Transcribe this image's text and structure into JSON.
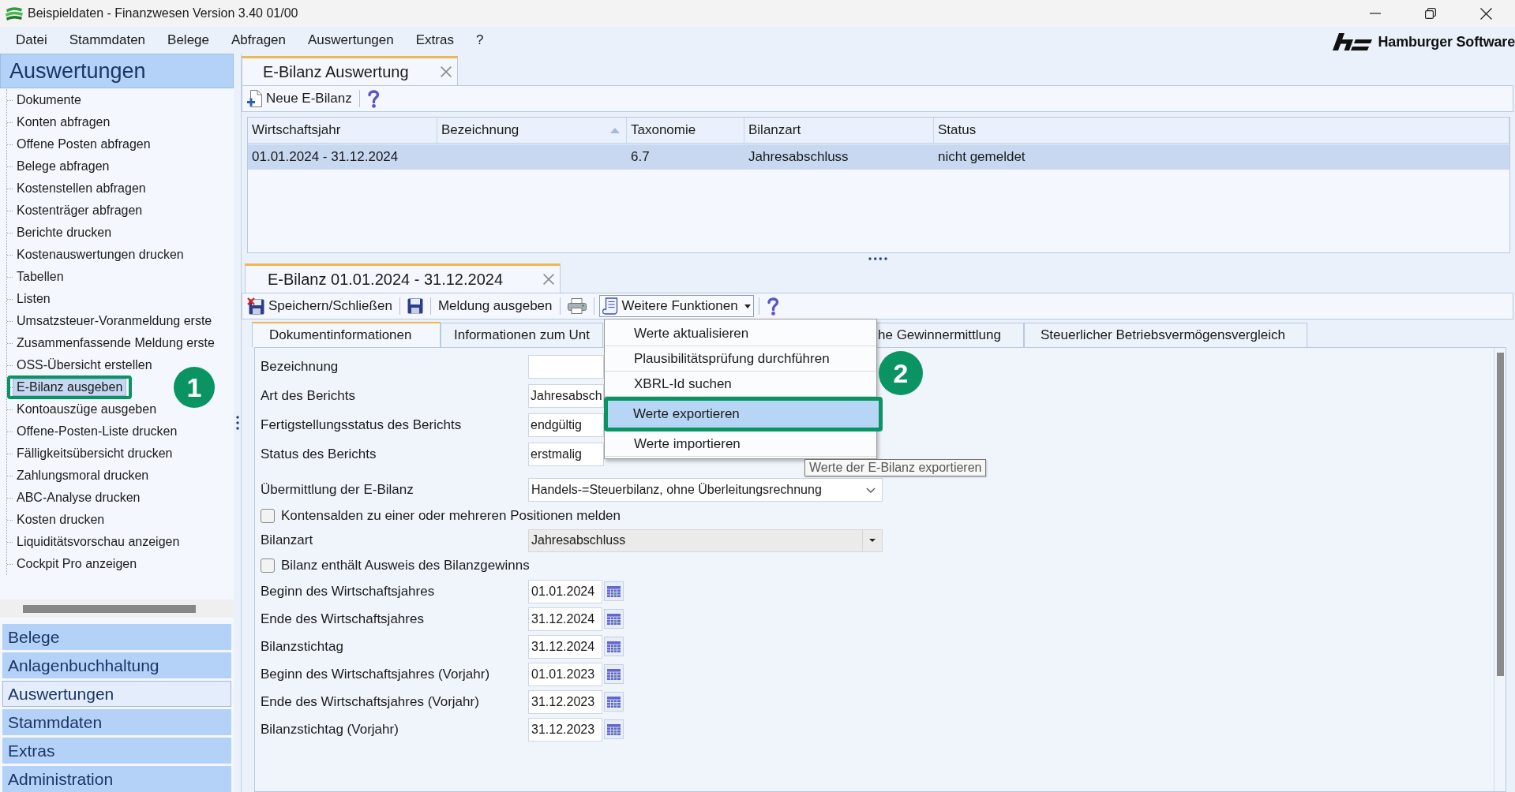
{
  "window": {
    "title": "Beispieldaten - Finanzwesen Version 3.40 01/00"
  },
  "menu_bar": [
    "Datei",
    "Stammdaten",
    "Belege",
    "Abfragen",
    "Auswertungen",
    "Extras",
    "?"
  ],
  "brand": "Hamburger Software",
  "sidebar": {
    "title": "Auswertungen",
    "items": [
      {
        "label": "Dokumente",
        "selected": false,
        "highlighted": false
      },
      {
        "label": "Konten abfragen",
        "selected": false,
        "highlighted": false
      },
      {
        "label": "Offene Posten abfragen",
        "selected": false,
        "highlighted": false
      },
      {
        "label": "Belege abfragen",
        "selected": false,
        "highlighted": false
      },
      {
        "label": "Kostenstellen abfragen",
        "selected": false,
        "highlighted": false
      },
      {
        "label": "Kostenträger abfragen",
        "selected": false,
        "highlighted": false
      },
      {
        "label": "Berichte drucken",
        "selected": false,
        "highlighted": false
      },
      {
        "label": "Kostenauswertungen drucken",
        "selected": false,
        "highlighted": false
      },
      {
        "label": "Tabellen",
        "selected": false,
        "highlighted": false
      },
      {
        "label": "Listen",
        "selected": false,
        "highlighted": false
      },
      {
        "label": "Umsatzsteuer-Voranmeldung erste",
        "selected": false,
        "highlighted": false
      },
      {
        "label": "Zusammenfassende Meldung erste",
        "selected": false,
        "highlighted": false
      },
      {
        "label": "OSS-Übersicht erstellen",
        "selected": false,
        "highlighted": false
      },
      {
        "label": "E-Bilanz ausgeben",
        "selected": true,
        "highlighted": true
      },
      {
        "label": "Kontoauszüge ausgeben",
        "selected": false,
        "highlighted": false
      },
      {
        "label": "Offene-Posten-Liste drucken",
        "selected": false,
        "highlighted": false
      },
      {
        "label": "Fälligkeitsübersicht drucken",
        "selected": false,
        "highlighted": false
      },
      {
        "label": "Zahlungsmoral drucken",
        "selected": false,
        "highlighted": false
      },
      {
        "label": "ABC-Analyse drucken",
        "selected": false,
        "highlighted": false
      },
      {
        "label": "Kosten drucken",
        "selected": false,
        "highlighted": false
      },
      {
        "label": "Liquiditätsvorschau anzeigen",
        "selected": false,
        "highlighted": false
      },
      {
        "label": "Cockpit Pro anzeigen",
        "selected": false,
        "highlighted": false
      }
    ],
    "sections": [
      {
        "label": "Belege",
        "selected": false
      },
      {
        "label": "Anlagenbuchhaltung",
        "selected": false
      },
      {
        "label": "Auswertungen",
        "selected": true
      },
      {
        "label": "Stammdaten",
        "selected": false
      },
      {
        "label": "Extras",
        "selected": false
      },
      {
        "label": "Administration",
        "selected": false
      }
    ]
  },
  "document_tab": {
    "label": "E-Bilanz Auswertung",
    "selected": true
  },
  "toolbar": [
    {
      "kind": "new",
      "label": "Neue E-Bilanz"
    },
    {
      "kind": "help"
    }
  ],
  "table": {
    "columns": [
      {
        "label": "Wirtschaftsjahr",
        "sorted": false
      },
      {
        "label": "Bezeichnung",
        "sorted": true
      },
      {
        "label": "Taxonomie",
        "sorted": false
      },
      {
        "label": "Bilanzart",
        "sorted": false
      },
      {
        "label": "Status",
        "sorted": false
      }
    ],
    "rows": [
      {
        "cells": [
          "01.01.2024 - 31.12.2024",
          null,
          "6.7",
          "Jahresabschluss",
          "nicht gemeldet"
        ],
        "selected": true
      }
    ]
  },
  "editor": {
    "tab": {
      "label": "E-Bilanz 01.01.2024 - 31.12.2024",
      "selected": true
    },
    "toolbar": [
      {
        "kind": "save_close",
        "label": "Speichern/Schließen"
      },
      {
        "kind": "save"
      },
      {
        "kind": "report",
        "label": "Meldung ausgeben"
      },
      {
        "kind": "print"
      },
      {
        "kind": "menu",
        "label": "Weitere Funktionen",
        "expanded": true
      },
      {
        "kind": "help"
      }
    ],
    "tabs": [
      {
        "label": "Dokumentinformationen",
        "selected": true
      },
      {
        "label": "Informationen zum Unt",
        "selected": false
      },
      {
        "label": "he Gewinnermittlung",
        "selected": false
      },
      {
        "label": "Steuerlicher Betriebsvermögensvergleich",
        "selected": false
      }
    ],
    "form": [
      {
        "kind": "text",
        "label": "Bezeichnung"
      },
      {
        "kind": "text",
        "label": "Art des Berichts",
        "value": "Jahresabsch"
      },
      {
        "kind": "text",
        "label": "Fertigstellungsstatus des Berichts",
        "value": "endgültig"
      },
      {
        "kind": "text",
        "label": "Status des Berichts",
        "value": "erstmalig"
      },
      {
        "kind": "combo",
        "label": "Übermittlung der E-Bilanz",
        "value": "Handels-=Steuerbilanz, ohne Überleitungsrechnung"
      },
      {
        "kind": "checkbox",
        "label": "Kontensalden zu einer oder mehreren Positionen melden",
        "checked": false
      },
      {
        "kind": "select",
        "label": "Bilanzart",
        "value": "Jahresabschluss"
      },
      {
        "kind": "checkbox",
        "label": "Bilanz enthält Ausweis des Bilanzgewinns",
        "checked": false
      },
      {
        "kind": "date",
        "label": "Beginn des Wirtschaftsjahres",
        "value": "01.01.2024"
      },
      {
        "kind": "date",
        "label": "Ende des Wirtschaftsjahres",
        "value": "31.12.2024"
      },
      {
        "kind": "date",
        "label": "Bilanzstichtag",
        "value": "31.12.2024"
      },
      {
        "kind": "date",
        "label": "Beginn des Wirtschaftsjahres (Vorjahr)",
        "value": "01.01.2023"
      },
      {
        "kind": "date",
        "label": "Ende des Wirtschaftsjahres (Vorjahr)",
        "value": "31.12.2023"
      },
      {
        "kind": "date",
        "label": "Bilanzstichtag (Vorjahr)",
        "value": "31.12.2023"
      }
    ]
  },
  "dropdown_menu": {
    "items": [
      {
        "label": "Werte aktualisieren",
        "selected": false,
        "highlighted": false
      },
      {
        "label": "Plausibilitätsprüfung durchführen",
        "selected": false,
        "highlighted": false
      },
      {
        "label": "XBRL-Id suchen",
        "selected": false,
        "highlighted": false
      },
      {
        "label": "Werte exportieren",
        "selected": true,
        "highlighted": true
      },
      {
        "label": "Werte importieren",
        "selected": false,
        "highlighted": false
      }
    ]
  },
  "tooltip": "Werte der E-Bilanz exportieren",
  "annotations": [
    {
      "number": "1"
    },
    {
      "number": "2"
    }
  ]
}
